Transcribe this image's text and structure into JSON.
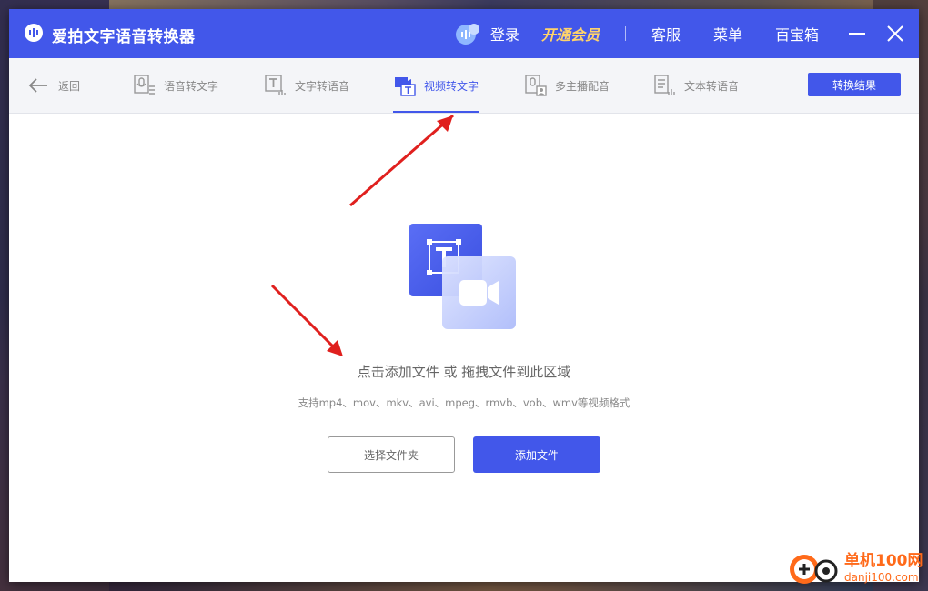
{
  "app": {
    "title": "爱拍文字语音转换器"
  },
  "titlebar": {
    "login": "登录",
    "vip": "开通会员",
    "items": [
      "客服",
      "菜单",
      "百宝箱"
    ]
  },
  "tabs": {
    "back": "返回",
    "items": [
      {
        "label": "语音转文字",
        "icon": "microphone-doc-icon"
      },
      {
        "label": "文字转语音",
        "icon": "text-to-audio-icon"
      },
      {
        "label": "视频转文字",
        "icon": "video-text-icon",
        "active": true
      },
      {
        "label": "多主播配音",
        "icon": "multi-anchor-icon"
      },
      {
        "label": "文本转语音",
        "icon": "doc-to-audio-icon"
      }
    ],
    "result_button": "转换结果"
  },
  "main": {
    "drop_text": "点击添加文件 或 拖拽文件到此区域",
    "hint": "支持mp4、mov、mkv、avi、mpeg、rmvb、vob、wmv等视频格式",
    "select_folder": "选择文件夹",
    "add_file": "添加文件"
  },
  "watermark": {
    "name": "单机100网",
    "url": "danji100.com"
  },
  "colors": {
    "accent": "#4257ea",
    "vip": "#ffd36b",
    "arrow": "#e0201e"
  }
}
